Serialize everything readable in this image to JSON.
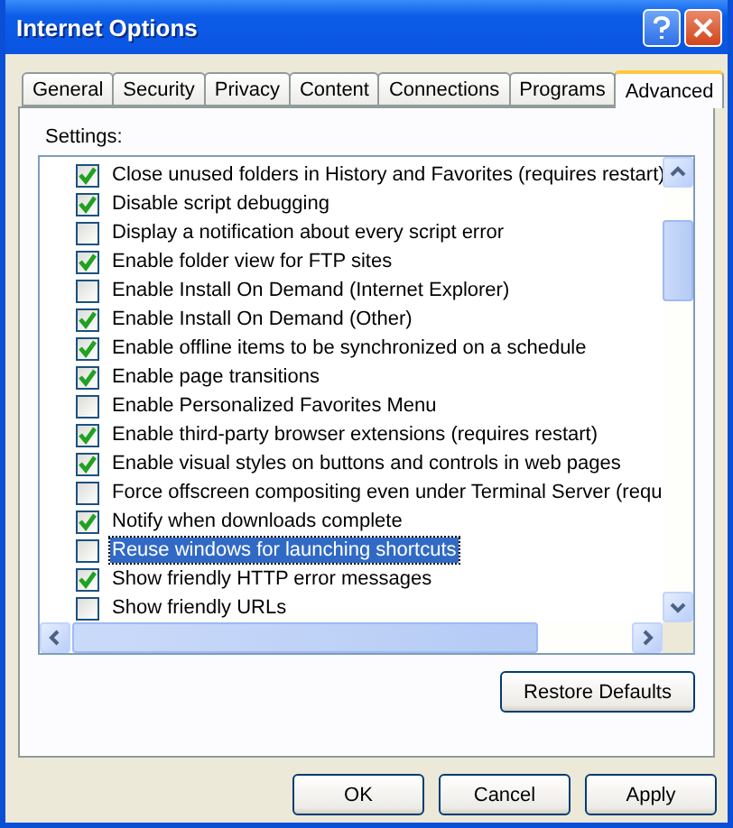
{
  "window": {
    "title": "Internet Options"
  },
  "tabs": [
    {
      "label": "General",
      "selected": false
    },
    {
      "label": "Security",
      "selected": false
    },
    {
      "label": "Privacy",
      "selected": false
    },
    {
      "label": "Content",
      "selected": false
    },
    {
      "label": "Connections",
      "selected": false
    },
    {
      "label": "Programs",
      "selected": false
    },
    {
      "label": "Advanced",
      "selected": true
    }
  ],
  "settings_label": "Settings:",
  "settings": [
    {
      "label": "Close unused folders in History and Favorites (requires restart)",
      "checked": true,
      "selected": false
    },
    {
      "label": "Disable script debugging",
      "checked": true,
      "selected": false
    },
    {
      "label": "Display a notification about every script error",
      "checked": false,
      "selected": false
    },
    {
      "label": "Enable folder view for FTP sites",
      "checked": true,
      "selected": false
    },
    {
      "label": "Enable Install On Demand (Internet Explorer)",
      "checked": false,
      "selected": false
    },
    {
      "label": "Enable Install On Demand (Other)",
      "checked": true,
      "selected": false
    },
    {
      "label": "Enable offline items to be synchronized on a schedule",
      "checked": true,
      "selected": false
    },
    {
      "label": "Enable page transitions",
      "checked": true,
      "selected": false
    },
    {
      "label": "Enable Personalized Favorites Menu",
      "checked": false,
      "selected": false
    },
    {
      "label": "Enable third-party browser extensions (requires restart)",
      "checked": true,
      "selected": false
    },
    {
      "label": "Enable visual styles on buttons and controls in web pages",
      "checked": true,
      "selected": false
    },
    {
      "label": "Force offscreen compositing even under Terminal Server (requ",
      "checked": false,
      "selected": false
    },
    {
      "label": "Notify when downloads complete",
      "checked": true,
      "selected": false
    },
    {
      "label": "Reuse windows for launching shortcuts",
      "checked": false,
      "selected": true
    },
    {
      "label": "Show friendly HTTP error messages",
      "checked": true,
      "selected": false
    },
    {
      "label": "Show friendly URLs",
      "checked": false,
      "selected": false
    }
  ],
  "restore_button": "Restore Defaults",
  "buttons": [
    "OK",
    "Cancel",
    "Apply"
  ]
}
